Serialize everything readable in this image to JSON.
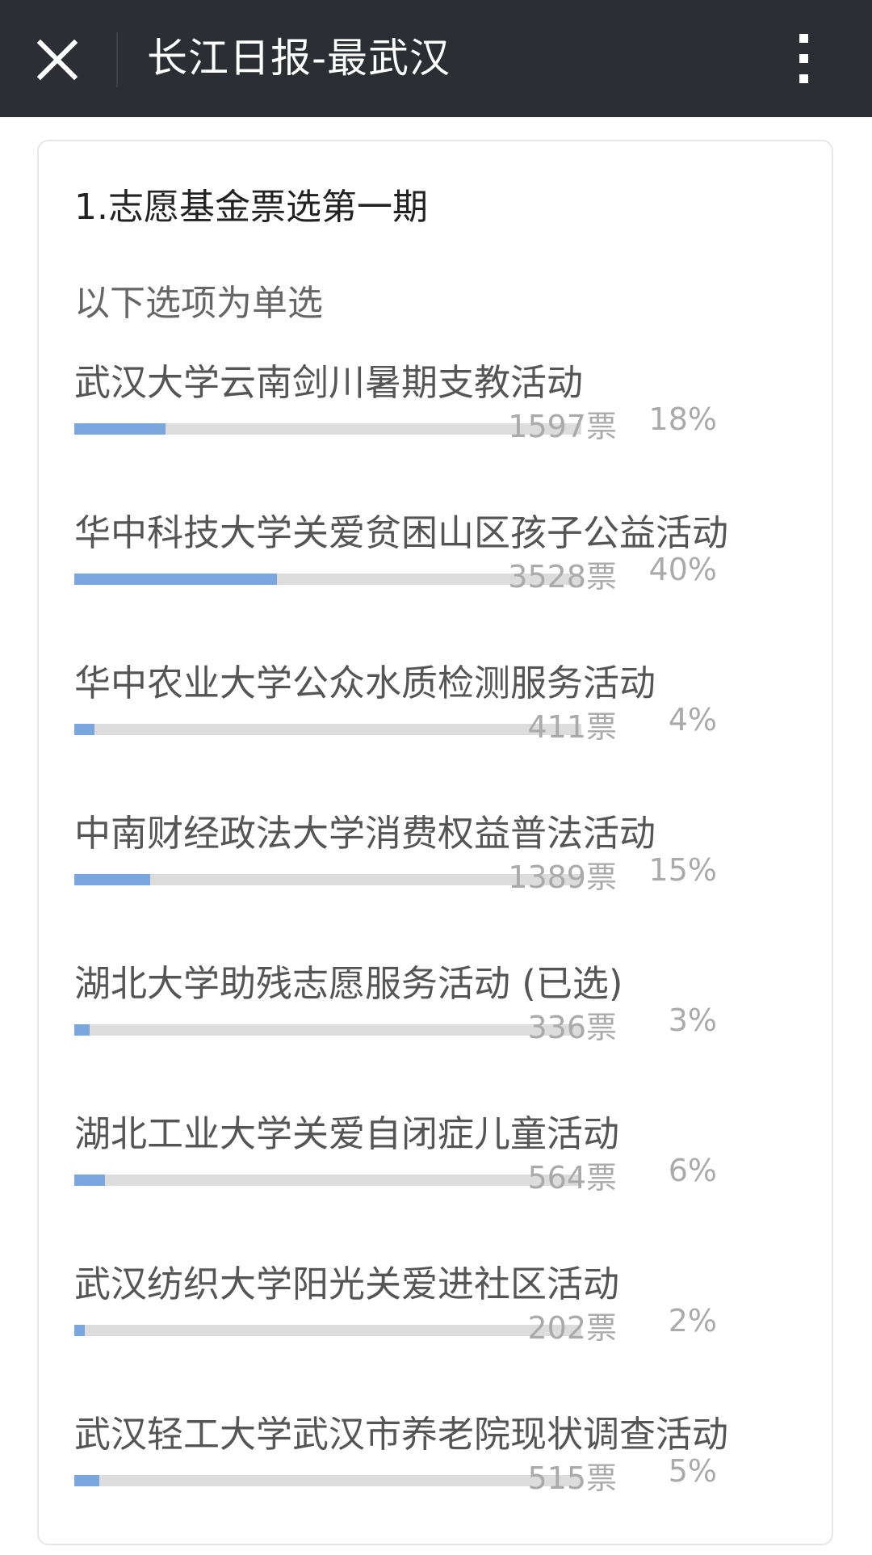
{
  "header": {
    "title": "长江日报-最武汉",
    "close_icon": "close-icon",
    "more_icon": "more-vertical-icon"
  },
  "poll": {
    "title": "1.志愿基金票选第一期",
    "subtitle": "以下选项为单选",
    "bar_color": "#79a7dd",
    "track_color": "#dcdcdc",
    "options": [
      {
        "label": "武汉大学云南剑川暑期支教活动",
        "votes": "1597票",
        "percent": "18%",
        "share": 0.18
      },
      {
        "label": "华中科技大学关爱贫困山区孩子公益活动",
        "votes": "3528票",
        "percent": "40%",
        "share": 0.4
      },
      {
        "label": "华中农业大学公众水质检测服务活动",
        "votes": "411票",
        "percent": "4%",
        "share": 0.04
      },
      {
        "label": "中南财经政法大学消费权益普法活动",
        "votes": "1389票",
        "percent": "15%",
        "share": 0.15
      },
      {
        "label": "湖北大学助残志愿服务活动 (已选)",
        "votes": "336票",
        "percent": "3%",
        "share": 0.03
      },
      {
        "label": "湖北工业大学关爱自闭症儿童活动",
        "votes": "564票",
        "percent": "6%",
        "share": 0.06
      },
      {
        "label": "武汉纺织大学阳光关爱进社区活动",
        "votes": "202票",
        "percent": "2%",
        "share": 0.02
      },
      {
        "label": "武汉轻工大学武汉市养老院现状调查活动",
        "votes": "515票",
        "percent": "5%",
        "share": 0.05
      }
    ]
  }
}
